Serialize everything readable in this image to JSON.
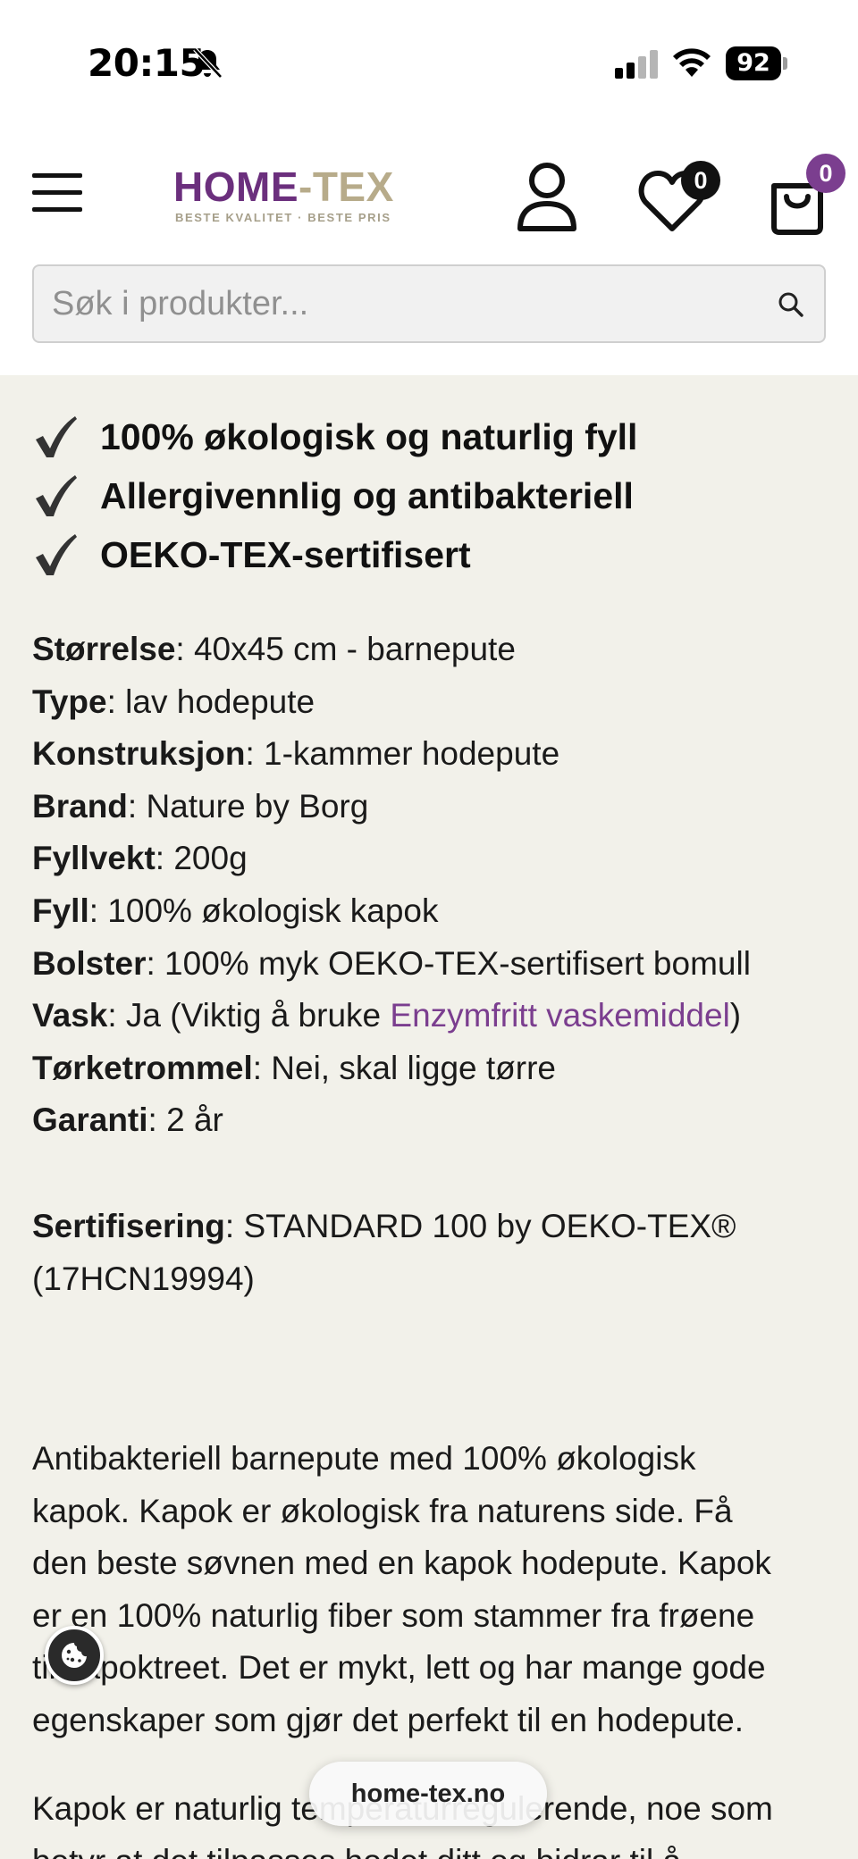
{
  "status_bar": {
    "time": "20:15",
    "battery": "92"
  },
  "header": {
    "logo": {
      "home": "HOME",
      "dash": "-",
      "tex": "TEX",
      "tagline": "BESTE KVALITET · BESTE PRIS"
    },
    "wishlist_count": "0",
    "cart_count": "0",
    "search": {
      "placeholder": "Søk i produkter..."
    },
    "icons": [
      "menu-icon",
      "user-icon",
      "heart-icon",
      "shopping-bag-icon",
      "search-icon"
    ]
  },
  "features": [
    "100% økologisk og naturlig fyll",
    "Allergivennlig og antibakteriell",
    "OEKO-TEX-sertifisert"
  ],
  "specs": [
    {
      "label": "Størrelse",
      "value": ": 40x45 cm - barnepute"
    },
    {
      "label": "Type",
      "value": ": lav hodepute"
    },
    {
      "label": "Konstruksjon",
      "value": ": 1-kammer hodepute"
    },
    {
      "label": "Brand",
      "value": ": Nature by Borg"
    },
    {
      "label": "Fyllvekt",
      "value": ": 200g"
    },
    {
      "label": "Fyll",
      "value": ": 100% økologisk kapok"
    },
    {
      "label": "Bolster",
      "value": ": 100% myk OEKO-TEX-sertifisert bomull"
    },
    {
      "label": "Vask",
      "value": ": Ja (Viktig å bruke ",
      "link": "Enzymfritt vaskemiddel",
      "after": ")"
    },
    {
      "label": "Tørketrommel",
      "value": ": Nei, skal ligge tørre"
    },
    {
      "label": "Garanti",
      "value": ": 2 år"
    }
  ],
  "certification": {
    "label": "Sertifisering",
    "line1": ": STANDARD 100 by OEKO-TEX®",
    "line2": "(17HCN19994)"
  },
  "description": {
    "paragraph1": [
      "Antibakteriell barnepute med 100% økologisk",
      "kapok. Kapok er økologisk fra naturens side. Få",
      "den beste søvnen med en kapok hodepute. Kapok",
      "er en 100% naturlig fiber som stammer fra frøene",
      "til kapoktreet. Det er mykt, lett og har mange gode",
      "egenskaper som gjør det perfekt til en hodepute."
    ],
    "paragraph2": [
      "Kapok er naturlig temperaturregulerende, noe som",
      "betyr at det tilpasses hodet ditt og bidrar til å"
    ]
  },
  "browser": {
    "url": "home-tex.no"
  },
  "colors": {
    "brand_purple": "#6b2f7d",
    "brand_beige": "#b7ab8a",
    "link": "#7b3e8f",
    "content_bg": "#f2f1ea"
  }
}
